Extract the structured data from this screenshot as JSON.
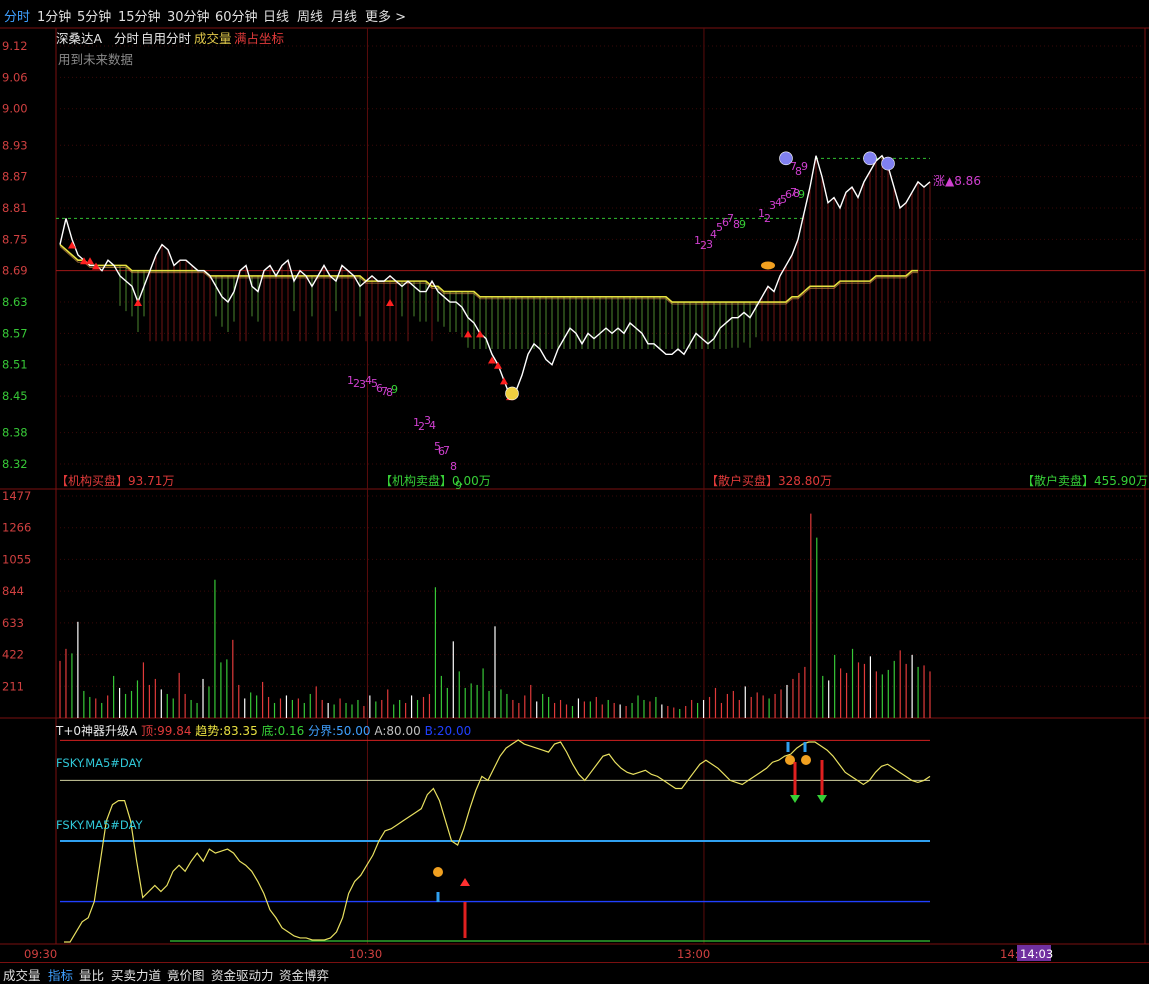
{
  "toolbar": {
    "tabs": [
      "分时",
      "1分钟",
      "5分钟",
      "15分钟",
      "30分钟",
      "60分钟",
      "日线",
      "周线",
      "月线",
      "更多 >"
    ],
    "active": "分时"
  },
  "price_panel": {
    "stock_name": "深桑达A",
    "tag_fenshi": "分时",
    "tag_custom": "自用分时",
    "tag_volume": "成交量",
    "tag_coord": "满占坐标",
    "note": "用到未来数据",
    "y_labels": [
      "9.12",
      "9.06",
      "9.00",
      "8.93",
      "8.87",
      "8.81",
      "8.75",
      "8.69",
      "8.63",
      "8.57",
      "8.51",
      "8.45",
      "8.38",
      "8.32"
    ],
    "price_tag": "涨▲8.86",
    "seq_a": [
      "1",
      "2",
      "3",
      "4",
      "5",
      "6",
      "7",
      "8",
      "9"
    ],
    "seq_b": [
      "1",
      "2",
      "3",
      "4",
      "5",
      "6",
      "7",
      "8",
      "9"
    ],
    "seq_c": [
      "1",
      "2",
      "3",
      "4",
      "5",
      "6",
      "7",
      "8",
      "9"
    ],
    "seq_d": [
      "1",
      "2",
      "3",
      "4",
      "5",
      "6",
      "7",
      "8",
      "9"
    ],
    "seq_e": [
      "7",
      "8",
      "9"
    ]
  },
  "flows": {
    "inst_buy_label": "【机构买盘】",
    "inst_buy_value": "93.71万",
    "inst_sell_label": "【机构卖盘】",
    "inst_sell_value": "0.00万",
    "retail_buy_label": "【散户买盘】",
    "retail_buy_value": "328.80万",
    "retail_sell_label": "【散户卖盘】",
    "retail_sell_value": "455.90万"
  },
  "volume_panel": {
    "y_labels": [
      "1477",
      "1266",
      "1055",
      "844",
      "633",
      "422",
      "211"
    ]
  },
  "indicator_panel": {
    "name": "T+0神器升级A",
    "ding_label": "顶:",
    "ding_value": "99.84",
    "trend_label": "趋势:",
    "trend_value": "83.35",
    "di_label": "底:",
    "di_value": "0.16",
    "fenjie_label": "分界:",
    "fenjie_value": "50.00",
    "a_label": "A:",
    "a_value": "80.00",
    "b_label": "B:",
    "b_value": "20.00",
    "ma_label_1": "FSKY.MA5#DAY",
    "ma_label_2": "FSKY.MA5#DAY"
  },
  "time_axis": {
    "labels": [
      "09:30",
      "10:30",
      "13:00",
      "14:"
    ],
    "cursor_time": "14:03"
  },
  "bottom_tabs": {
    "tabs": [
      "成交量",
      "指标",
      "量比",
      "买卖力道",
      "竟价图",
      "资金驱动力",
      "资金博弈"
    ],
    "active": "指标"
  },
  "chart_data": [
    {
      "type": "line",
      "name": "intraday-price",
      "y_range": [
        8.32,
        9.12
      ],
      "prev_close": 8.69,
      "day_high": 8.91,
      "day_low": 8.44,
      "x_axis_labels": [
        "09:30",
        "10:30",
        "13:00",
        "14:"
      ],
      "series": [
        {
          "name": "price",
          "values": [
            8.74,
            8.79,
            8.75,
            8.72,
            8.71,
            8.7,
            8.7,
            8.69,
            8.71,
            8.7,
            8.68,
            8.67,
            8.66,
            8.63,
            8.66,
            8.69,
            8.72,
            8.74,
            8.73,
            8.7,
            8.71,
            8.71,
            8.7,
            8.69,
            8.69,
            8.68,
            8.66,
            8.64,
            8.63,
            8.65,
            8.69,
            8.7,
            8.66,
            8.65,
            8.69,
            8.7,
            8.68,
            8.7,
            8.71,
            8.67,
            8.69,
            8.68,
            8.66,
            8.68,
            8.7,
            8.68,
            8.67,
            8.7,
            8.69,
            8.68,
            8.66,
            8.67,
            8.68,
            8.67,
            8.67,
            8.68,
            8.67,
            8.66,
            8.67,
            8.66,
            8.65,
            8.65,
            8.67,
            8.65,
            8.64,
            8.63,
            8.63,
            8.62,
            8.6,
            8.59,
            8.57,
            8.56,
            8.53,
            8.51,
            8.48,
            8.45,
            8.46,
            8.49,
            8.53,
            8.55,
            8.54,
            8.52,
            8.51,
            8.54,
            8.56,
            8.58,
            8.57,
            8.55,
            8.57,
            8.56,
            8.57,
            8.58,
            8.57,
            8.58,
            8.57,
            8.59,
            8.58,
            8.57,
            8.55,
            8.55,
            8.54,
            8.53,
            8.53,
            8.54,
            8.53,
            8.55,
            8.57,
            8.56,
            8.55,
            8.56,
            8.58,
            8.59,
            8.6,
            8.6,
            8.61,
            8.6,
            8.62,
            8.64,
            8.66,
            8.65,
            8.68,
            8.7,
            8.72,
            8.75,
            8.8,
            8.85,
            8.91,
            8.87,
            8.82,
            8.83,
            8.81,
            8.84,
            8.85,
            8.83,
            8.86,
            8.88,
            8.9,
            8.91,
            8.89,
            8.85,
            8.81,
            8.82,
            8.84,
            8.86,
            8.85,
            8.86
          ]
        },
        {
          "name": "avg",
          "values": [
            8.74,
            8.73,
            8.72,
            8.71,
            8.71,
            8.7,
            8.7,
            8.7,
            8.7,
            8.7,
            8.7,
            8.7,
            8.69,
            8.69,
            8.69,
            8.69,
            8.69,
            8.69,
            8.69,
            8.69,
            8.69,
            8.69,
            8.69,
            8.69,
            8.69,
            8.68,
            8.68,
            8.68,
            8.68,
            8.68,
            8.68,
            8.68,
            8.68,
            8.68,
            8.68,
            8.68,
            8.68,
            8.68,
            8.68,
            8.68,
            8.68,
            8.68,
            8.68,
            8.68,
            8.68,
            8.68,
            8.68,
            8.68,
            8.68,
            8.68,
            8.68,
            8.67,
            8.67,
            8.67,
            8.67,
            8.67,
            8.67,
            8.67,
            8.67,
            8.67,
            8.67,
            8.67,
            8.66,
            8.66,
            8.65,
            8.65,
            8.65,
            8.65,
            8.65,
            8.65,
            8.64,
            8.64,
            8.64,
            8.64,
            8.64,
            8.64,
            8.64,
            8.64,
            8.64,
            8.64,
            8.64,
            8.64,
            8.64,
            8.64,
            8.64,
            8.64,
            8.64,
            8.64,
            8.64,
            8.64,
            8.64,
            8.64,
            8.64,
            8.64,
            8.64,
            8.64,
            8.64,
            8.64,
            8.64,
            8.64,
            8.64,
            8.64,
            8.63,
            8.63,
            8.63,
            8.63,
            8.63,
            8.63,
            8.63,
            8.63,
            8.63,
            8.63,
            8.63,
            8.63,
            8.63,
            8.63,
            8.63,
            8.63,
            8.63,
            8.63,
            8.63,
            8.63,
            8.64,
            8.64,
            8.65,
            8.66,
            8.66,
            8.66,
            8.66,
            8.66,
            8.67,
            8.67,
            8.67,
            8.67,
            8.67,
            8.67,
            8.68,
            8.68,
            8.68,
            8.68,
            8.68,
            8.68,
            8.69,
            8.69
          ]
        }
      ]
    },
    {
      "type": "bar",
      "name": "volume",
      "y_range": [
        0,
        1477
      ],
      "series": [
        {
          "name": "volume",
          "values": [
            380,
            460,
            430,
            640,
            180,
            140,
            130,
            100,
            150,
            280,
            200,
            160,
            180,
            250,
            370,
            220,
            260,
            190,
            160,
            130,
            300,
            160,
            120,
            100,
            260,
            210,
            920,
            370,
            390,
            520,
            220,
            130,
            170,
            150,
            240,
            140,
            100,
            130,
            150,
            120,
            130,
            100,
            160,
            210,
            120,
            100,
            90,
            130,
            100,
            90,
            120,
            80,
            150,
            110,
            120,
            190,
            90,
            120,
            100,
            150,
            120,
            140,
            160,
            870,
            280,
            200,
            510,
            310,
            200,
            230,
            220,
            330,
            180,
            610,
            190,
            160,
            120,
            100,
            150,
            220,
            110,
            160,
            140,
            100,
            120,
            90,
            80,
            130,
            110,
            110,
            140,
            90,
            120,
            100,
            90,
            80,
            100,
            150,
            120,
            110,
            140,
            90,
            80,
            70,
            60,
            80,
            120,
            100,
            120,
            140,
            200,
            100,
            160,
            180,
            120,
            210,
            140,
            170,
            150,
            130,
            160,
            190,
            220,
            260,
            300,
            340,
            1360,
            1200,
            280,
            250,
            420,
            330,
            300,
            460,
            370,
            360,
            410,
            310,
            290,
            320,
            380,
            450,
            360,
            420,
            340,
            350,
            310
          ]
        }
      ]
    },
    {
      "type": "line",
      "name": "T+0-indicator",
      "y_range": [
        0,
        100
      ],
      "reference_lines": {
        "A": 80,
        "B": 20,
        "fenjie": 50,
        "ding": 99.84,
        "di": 0.16
      },
      "series": [
        {
          "name": "trend",
          "values": [
            0,
            0,
            5,
            10,
            12,
            20,
            40,
            60,
            68,
            70,
            70,
            60,
            40,
            22,
            25,
            28,
            25,
            28,
            35,
            38,
            35,
            40,
            44,
            40,
            46,
            44,
            45,
            46,
            44,
            40,
            38,
            35,
            30,
            24,
            16,
            12,
            7,
            5,
            3,
            2,
            2,
            1,
            1,
            1,
            2,
            5,
            12,
            24,
            30,
            33,
            38,
            43,
            50,
            55,
            56,
            58,
            60,
            62,
            64,
            66,
            73,
            76,
            70,
            60,
            50,
            48,
            56,
            66,
            75,
            82,
            80,
            86,
            92,
            96,
            98,
            100,
            98,
            97,
            96,
            95,
            94,
            98,
            99,
            94,
            88,
            83,
            80,
            84,
            88,
            92,
            93,
            89,
            86,
            84,
            83,
            84,
            85,
            83,
            82,
            80,
            78,
            76,
            76,
            80,
            84,
            88,
            90,
            88,
            86,
            83,
            80,
            79,
            78,
            80,
            82,
            84,
            86,
            89,
            90,
            92,
            93,
            96,
            98,
            99,
            99,
            97,
            95,
            92,
            88,
            84,
            82,
            80,
            78,
            80,
            84,
            87,
            88,
            86,
            84,
            82,
            80,
            79,
            80,
            82
          ]
        }
      ]
    }
  ]
}
